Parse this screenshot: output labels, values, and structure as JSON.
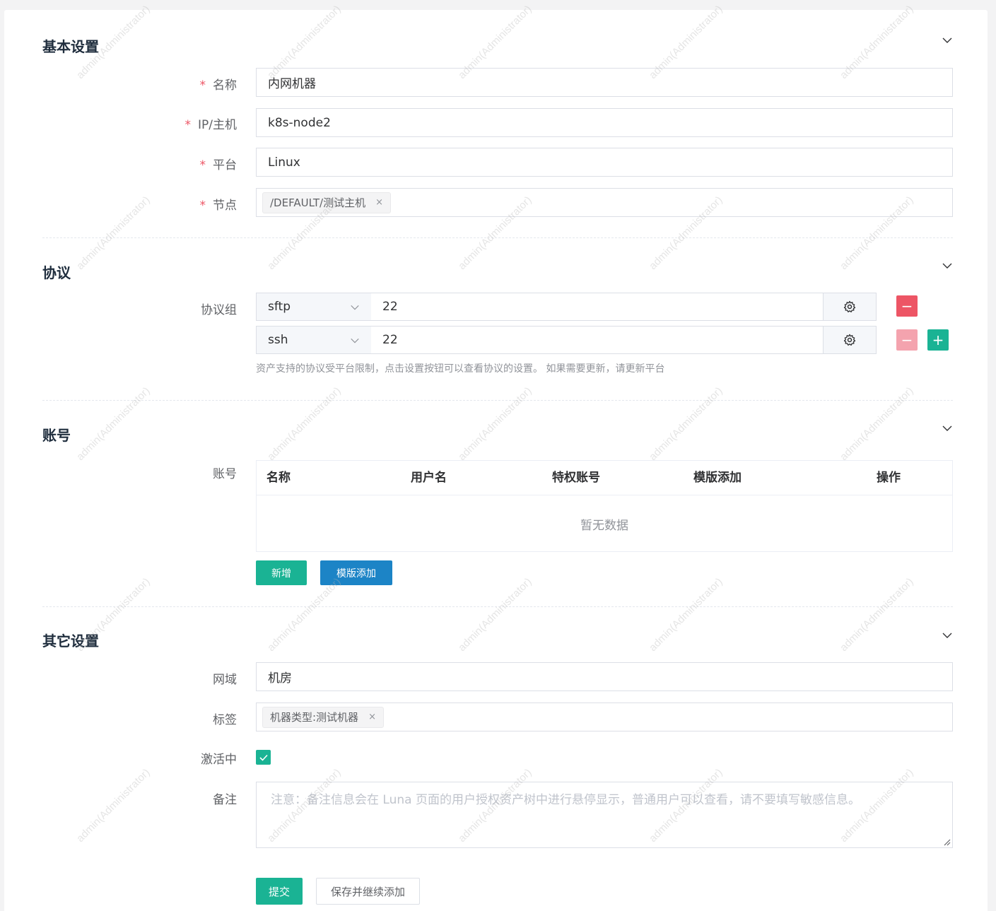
{
  "watermark_text": "admin(Administrator)",
  "sections": {
    "basic": {
      "title": "基本设置"
    },
    "protocol": {
      "title": "协议"
    },
    "account": {
      "title": "账号"
    },
    "other": {
      "title": "其它设置"
    }
  },
  "basic": {
    "name": {
      "label": "名称",
      "value": "内网机器",
      "required_mark": "*"
    },
    "host": {
      "label": "IP/主机",
      "value": "k8s-node2",
      "required_mark": "*"
    },
    "platform": {
      "label": "平台",
      "value": "Linux",
      "required_mark": "*"
    },
    "node": {
      "label": "节点",
      "tag": "/DEFAULT/测试主机",
      "tag_close": "×",
      "required_mark": "*"
    }
  },
  "protocol": {
    "label": "协议组",
    "rows": [
      {
        "name": "sftp",
        "port": "22"
      },
      {
        "name": "ssh",
        "port": "22"
      }
    ],
    "remove_label": "−",
    "add_label": "+",
    "hint": "资产支持的协议受平台限制，点击设置按钮可以查看协议的设置。 如果需要更新，请更新平台"
  },
  "account": {
    "label": "账号",
    "columns": [
      "名称",
      "用户名",
      "特权账号",
      "模版添加",
      "操作"
    ],
    "empty_text": "暂无数据",
    "add_button": "新增",
    "template_button": "模版添加"
  },
  "other": {
    "domain": {
      "label": "网域",
      "value": "机房"
    },
    "labels": {
      "label": "标签",
      "tag": "机器类型:测试机器",
      "tag_close": "×"
    },
    "active": {
      "label": "激活中",
      "checked": true
    },
    "comment": {
      "label": "备注",
      "placeholder": "注意：备注信息会在 Luna 页面的用户授权资产树中进行悬停显示，普通用户可以查看，请不要填写敏感信息。"
    }
  },
  "footer": {
    "submit": "提交",
    "save_continue": "保存并继续添加"
  },
  "colors": {
    "primary": "#1ab394",
    "info": "#1c84c6",
    "danger": "#ed5565",
    "danger_disabled": "#f4a3ae",
    "required": "#ed5565"
  }
}
